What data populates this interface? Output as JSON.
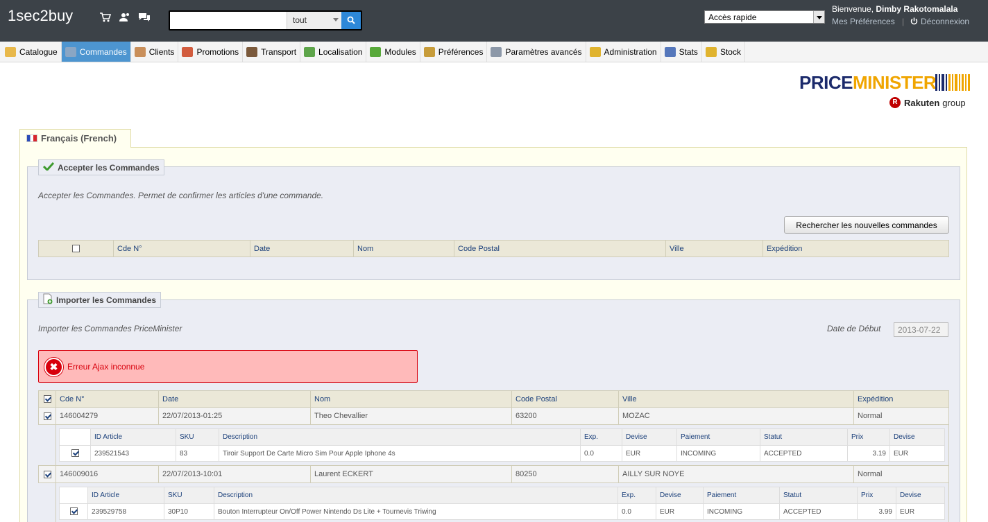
{
  "header": {
    "shop_name": "1sec2buy",
    "quick_icons": [
      "cart-icon",
      "users-icon",
      "messages-icon"
    ],
    "search": {
      "value": "",
      "scope": "tout"
    },
    "quick_access": "Accès rapide",
    "welcome_prefix": "Bienvenue,",
    "user_name": "Dimby Rakotomalala",
    "prefs_label": "Mes Préférences",
    "separator": "|",
    "logout_label": "Déconnexion"
  },
  "nav": {
    "items": [
      {
        "label": "Catalogue",
        "icon": "folder-icon",
        "color": "#e8b84a"
      },
      {
        "label": "Commandes",
        "icon": "cart-icon",
        "color": "#8aa6c4"
      },
      {
        "label": "Clients",
        "icon": "user-icon",
        "color": "#c98f5a"
      },
      {
        "label": "Promotions",
        "icon": "promo-icon",
        "color": "#d25c3e"
      },
      {
        "label": "Transport",
        "icon": "truck-icon",
        "color": "#7b5a3c"
      },
      {
        "label": "Localisation",
        "icon": "globe-icon",
        "color": "#5ea54a"
      },
      {
        "label": "Modules",
        "icon": "puzzle-icon",
        "color": "#58a93a"
      },
      {
        "label": "Préférences",
        "icon": "prefs-icon",
        "color": "#c79c3a"
      },
      {
        "label": "Paramètres avancés",
        "icon": "wrench-icon",
        "color": "#8c98a8"
      },
      {
        "label": "Administration",
        "icon": "key-icon",
        "color": "#e0b32e"
      },
      {
        "label": "Stats",
        "icon": "chart-icon",
        "color": "#5577bb"
      },
      {
        "label": "Stock",
        "icon": "stock-icon",
        "color": "#e0b32e"
      }
    ],
    "active_index": 1
  },
  "logo": {
    "part1": "PRICE",
    "part2": "MINISTER",
    "badge": "R",
    "rakuten": "Rakuten",
    "group": "group"
  },
  "lang_tab": "Français (French)",
  "accept": {
    "legend": "Accepter les Commandes",
    "description": "Accepter les Commandes. Permet de confirmer les articles d'une commande.",
    "button": "Rechercher les nouvelles commandes",
    "columns": [
      "Cde N°",
      "Date",
      "Nom",
      "Code Postal",
      "Ville",
      "Expédition"
    ]
  },
  "import": {
    "legend": "Importer les Commandes",
    "description": "Importer les Commandes PriceMinister",
    "date_label": "Date de Début",
    "date_value": "2013-07-22",
    "error_icon": "✖",
    "error": "Erreur Ajax inconnue",
    "columns": [
      "Cde N°",
      "Date",
      "Nom",
      "Code Postal",
      "Ville",
      "Expédition"
    ],
    "detail_columns": [
      "ID Article",
      "SKU",
      "Description",
      "Exp.",
      "Devise",
      "Paiement",
      "Statut",
      "Prix",
      "Devise"
    ],
    "orders": [
      {
        "number": "146004279",
        "date": "22/07/2013-01:25",
        "name": "Theo Chevallier",
        "postal": "63200",
        "city": "MOZAC",
        "shipping": "Normal",
        "items": [
          {
            "id": "239521543",
            "sku": "83",
            "description": "Tiroir Support De Carte Micro Sim Pour Apple Iphone 4s",
            "exp": "0.0",
            "currency": "EUR",
            "payment": "INCOMING",
            "status": "ACCEPTED",
            "price": "3.19",
            "currency2": "EUR"
          }
        ]
      },
      {
        "number": "146009016",
        "date": "22/07/2013-10:01",
        "name": "Laurent ECKERT",
        "postal": "80250",
        "city": "AILLY SUR NOYE",
        "shipping": "Normal",
        "items": [
          {
            "id": "239529758",
            "sku": "30P10",
            "description": "Bouton Interrupteur On/Off Power Nintendo Ds Lite + Tournevis Triwing",
            "exp": "0.0",
            "currency": "EUR",
            "payment": "INCOMING",
            "status": "ACCEPTED",
            "price": "3.99",
            "currency2": "EUR"
          }
        ]
      }
    ]
  }
}
